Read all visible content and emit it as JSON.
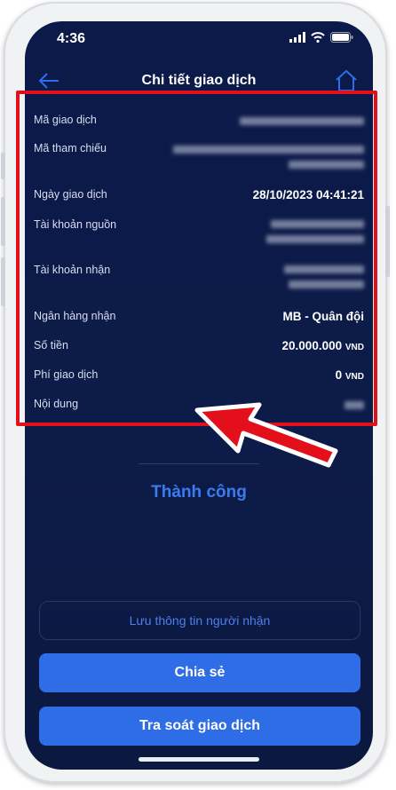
{
  "status_bar": {
    "time": "4:36"
  },
  "header": {
    "title": "Chi tiết giao dịch"
  },
  "details": [
    {
      "label": "Mã giao dịch"
    },
    {
      "label": "Mã tham chiếu"
    },
    {
      "label": "Ngày giao dịch",
      "value": "28/10/2023 04:41:21"
    },
    {
      "label": "Tài khoản nguồn"
    },
    {
      "label": "Tài khoản nhận"
    },
    {
      "label": "Ngân hàng nhận",
      "value": "MB - Quân đội"
    },
    {
      "label": "Số tiền",
      "value": "20.000.000",
      "unit": "VND"
    },
    {
      "label": "Phí giao dịch",
      "value": "0",
      "unit": "VND"
    },
    {
      "label": "Nội dung"
    }
  ],
  "result": {
    "status": "Thành công"
  },
  "actions": {
    "save_recipient": "Lưu thông tin người nhận",
    "share": "Chia sẻ",
    "inquiry": "Tra soát giao dịch"
  },
  "colors": {
    "highlight": "#e3101c",
    "primary": "#2f6de6",
    "background": "#0c1a4a"
  },
  "icons": [
    "back-arrow-icon",
    "home-icon",
    "signal-icon",
    "wifi-icon",
    "battery-icon",
    "pointer-arrow-icon"
  ]
}
